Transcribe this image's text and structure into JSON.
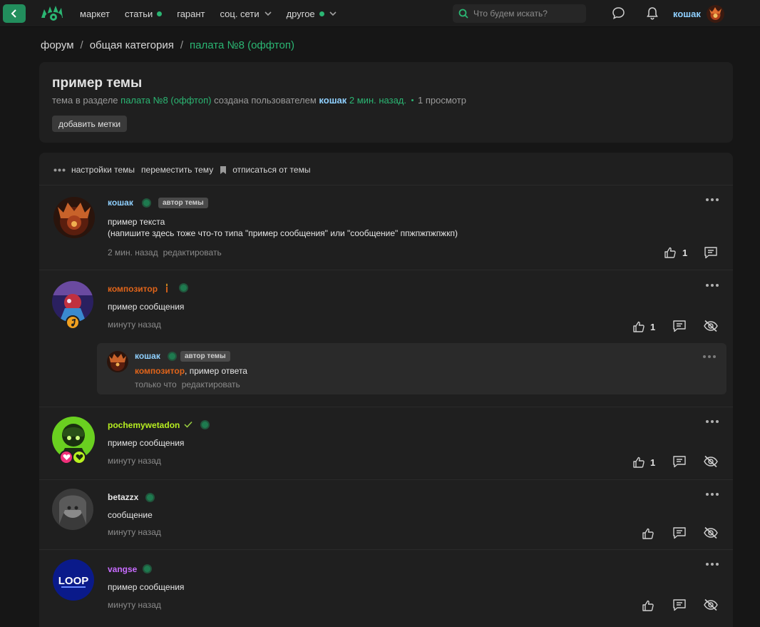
{
  "topbar": {
    "nav": [
      {
        "label": "маркет",
        "dot": false,
        "chevron": false
      },
      {
        "label": "статьи",
        "dot": true,
        "chevron": false
      },
      {
        "label": "гарант",
        "dot": false,
        "chevron": false
      },
      {
        "label": "соц. сети",
        "dot": false,
        "chevron": true
      },
      {
        "label": "другое",
        "dot": true,
        "chevron": true
      }
    ],
    "search_placeholder": "Что будем искать?",
    "username": "кошак"
  },
  "breadcrumb": {
    "items": [
      "форум",
      "общая категория"
    ],
    "current": "палата №8 (оффтоп)",
    "separator": "/"
  },
  "thread": {
    "title": "пример темы",
    "meta_prefix": "тема в разделе",
    "section": "палата №8 (оффтоп)",
    "meta_mid": "созданa пользователем",
    "author": "кошак",
    "time": "2 мин. назад.",
    "views": "1 просмотр",
    "add_tags_label": "добавить метки"
  },
  "thread_actions": {
    "settings": "настройки темы",
    "move": "переместить тему",
    "unsubscribe": "отписаться от темы"
  },
  "posts": [
    {
      "username": "кошак",
      "name_color": "#8fd0ff",
      "badge": "автор темы",
      "text_line1": "пример текста",
      "text_line2": "(напишите здесь тоже что-то типа \"пример сообщения\" или \"сообщение\" ппжпжпжпжкп)",
      "time": "2 мин. назад",
      "edit": "редактировать",
      "likes": "1"
    },
    {
      "username": "композитор",
      "name_color": "#e0641a",
      "text": "пример сообщения",
      "time": "минуту назад",
      "likes": "1",
      "reply": {
        "username": "кошак",
        "badge": "автор темы",
        "mention": "композитор",
        "text": ", пример ответа",
        "time": "только что",
        "edit": "редактировать"
      }
    },
    {
      "username": "pochemywetadon",
      "name_color": "#b8f020",
      "text": "пример сообщения",
      "time": "минуту назад",
      "likes": "1"
    },
    {
      "username": "betazzx",
      "name_color": "#e6e6e6",
      "text": "сообщение",
      "time": "минуту назад"
    },
    {
      "username": "vangse",
      "name_color": "#c86cff",
      "text": "пример сообщения",
      "time": "минуту назад",
      "avatar_text": "LOOP"
    }
  ],
  "colors": {
    "accent": "#2bb673",
    "background": "#161616",
    "card": "#1f1f1f"
  }
}
